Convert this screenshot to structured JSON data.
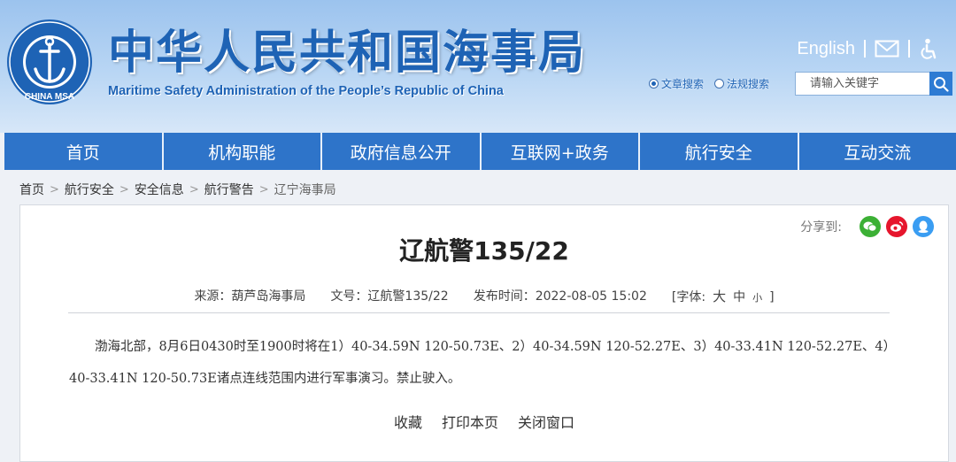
{
  "header": {
    "site_title": "中华人民共和国海事局",
    "site_subtitle": "Maritime Safety Administration of the People’s Republic of China",
    "logo_text": "CHINA MSA",
    "english_link": "English",
    "icons": [
      "mail-icon",
      "accessibility-icon",
      "search-icon"
    ],
    "search": {
      "types": [
        {
          "label": "文章搜索",
          "selected": true
        },
        {
          "label": "法规搜索",
          "selected": false
        }
      ],
      "placeholder": "请输入关键字"
    }
  },
  "nav": {
    "items": [
      {
        "label": "首页"
      },
      {
        "label": "机构职能"
      },
      {
        "label": "政府信息公开"
      },
      {
        "label": "互联网+政务"
      },
      {
        "label": "航行安全"
      },
      {
        "label": "互动交流"
      }
    ]
  },
  "breadcrumb": [
    {
      "label": "首页"
    },
    {
      "label": "航行安全"
    },
    {
      "label": "安全信息"
    },
    {
      "label": "航行警告"
    },
    {
      "label": "辽宁海事局"
    }
  ],
  "article": {
    "share_label": "分享到:",
    "share_icons": [
      "wechat-icon",
      "weibo-icon",
      "qq-icon"
    ],
    "title": "辽航警135/22",
    "source": "来源：葫芦岛海事局",
    "doc_no": "文号：辽航警135/22",
    "publish_time": "发布时间：2022-08-05 15:02",
    "font_size_label": "[字体:",
    "font_sizes": [
      "大",
      "中",
      "小"
    ],
    "font_size_close": "]",
    "body": "渤海北部，8月6日0430时至1900时将在1）40-34.59N 120-50.73E、2）40-34.59N 120-52.27E、3）40-33.41N 120-52.27E、4）40-33.41N 120-50.73E诸点连线范围内进行军事演习。禁止驶入。",
    "actions": {
      "favorite": "收藏",
      "print": "打印本页",
      "close": "关闭窗口"
    }
  },
  "colors": {
    "brand_blue": "#1e63b5",
    "nav_blue": "#2e74c9",
    "wechat": "#3cb035",
    "weibo": "#e6162d",
    "qq": "#3a9df2"
  }
}
